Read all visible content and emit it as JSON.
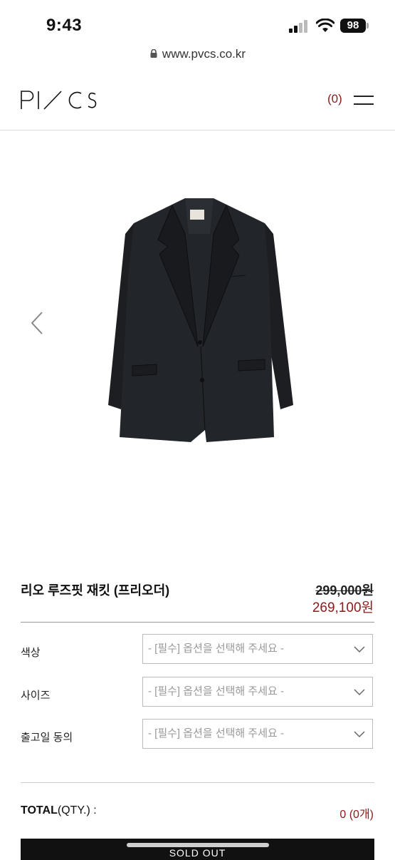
{
  "status_bar": {
    "time": "9:43",
    "battery": "98"
  },
  "browser": {
    "url": "www.pvcs.co.kr"
  },
  "header": {
    "logo": "PVCS",
    "cart_count": "(0)"
  },
  "product": {
    "name": "리오 루즈핏 재킷 (프리오더)",
    "original_price": "299,000원",
    "sale_price": "269,100원"
  },
  "options": [
    {
      "label": "색상",
      "placeholder": "- [필수] 옵션을 선택해 주세요 -"
    },
    {
      "label": "사이즈",
      "placeholder": "- [필수] 옵션을 선택해 주세요 -"
    },
    {
      "label": "출고일 동의",
      "placeholder": "- [필수] 옵션을 선택해 주세요 -"
    }
  ],
  "total": {
    "label_bold": "TOTAL",
    "label_rest": "(QTY.) :",
    "value": "0 (0개)"
  },
  "buttons": {
    "soldout": "SOLD OUT"
  },
  "colors": {
    "accent": "#8b1a1a",
    "jacket": "#1f2126"
  }
}
